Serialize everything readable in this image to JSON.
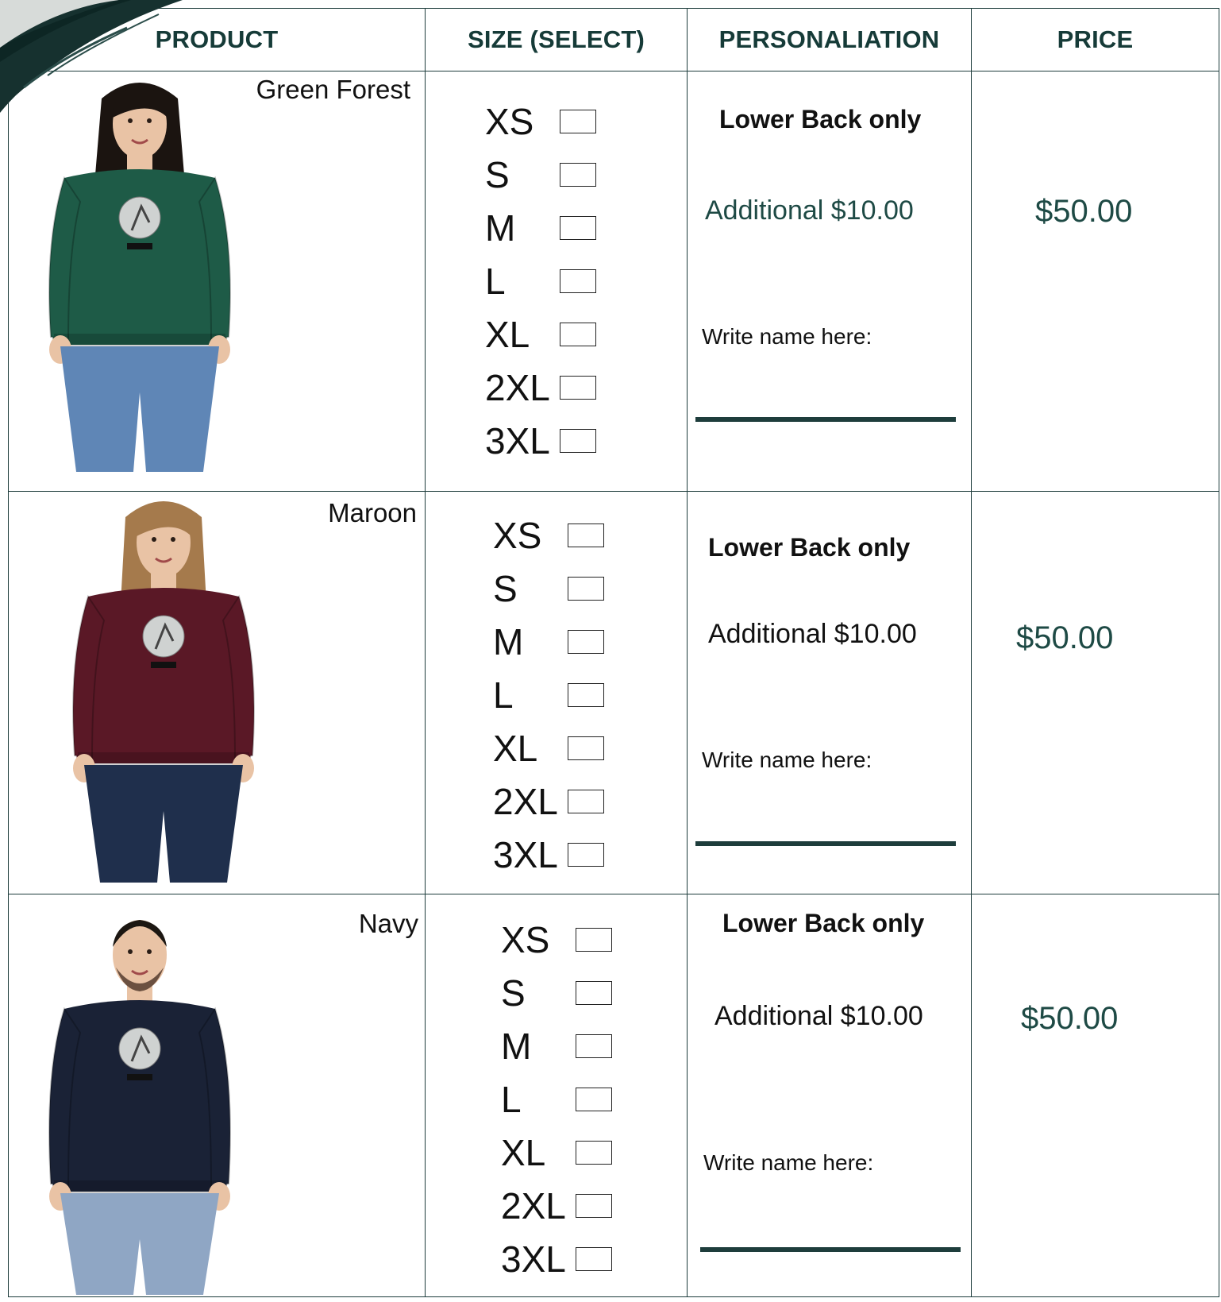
{
  "headers": {
    "product": "PRODUCT",
    "size": "SIZE (SELECT)",
    "personalization": "PERSONALIATION",
    "price": "PRICE"
  },
  "products": [
    {
      "color_name": "Green Forest",
      "sweater_color": "#1e5b47",
      "hair_color": "#1b1410",
      "pants_color": "#5f86b6",
      "sizes": [
        "XS",
        "S",
        "M",
        "L",
        "XL",
        "2XL",
        "3XL"
      ],
      "lower_back": "Lower Back only",
      "additional": "Additional $10.00",
      "additional_color": "#1e4a45",
      "write_name": "Write name here:",
      "price": "$50.00"
    },
    {
      "color_name": "Maroon",
      "sweater_color": "#5a1826",
      "hair_color": "#a57a4c",
      "pants_color": "#1f2f4c",
      "sizes": [
        "XS",
        "S",
        "M",
        "L",
        "XL",
        "2XL",
        "3XL"
      ],
      "lower_back": "Lower Back only",
      "additional": "Additional $10.00",
      "additional_color": "#111111",
      "write_name": "Write name here:",
      "price": "$50.00"
    },
    {
      "color_name": "Navy",
      "sweater_color": "#1a2236",
      "hair_color": "#1c1712",
      "pants_color": "#8fa6c4",
      "sizes": [
        "XS",
        "S",
        "M",
        "L",
        "XL",
        "2XL",
        "3XL"
      ],
      "lower_back": "Lower Back only",
      "additional": "Additional $10.00",
      "additional_color": "#111111",
      "write_name": "Write name here:",
      "price": "$50.00"
    }
  ],
  "colors": {
    "accent": "#1e3d3c",
    "border": "#1e3d3c",
    "header_text": "#163b38"
  }
}
